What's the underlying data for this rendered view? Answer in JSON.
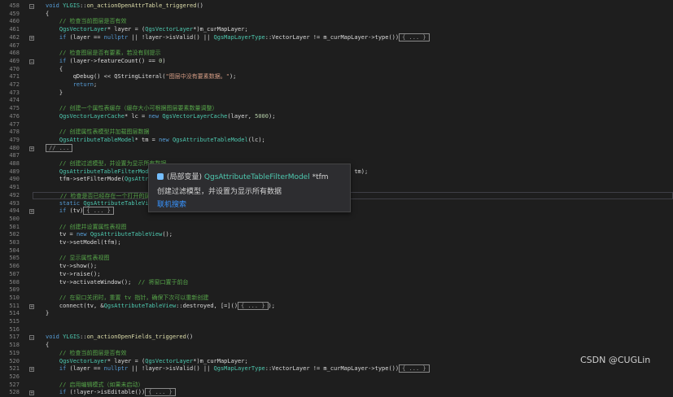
{
  "lines": [
    {
      "num": "458",
      "text": "void YLGIS::on_actionOpenAttrTable_triggered()",
      "type": "fn",
      "fold": "−"
    },
    {
      "num": "459",
      "text": "{",
      "type": "plain"
    },
    {
      "num": "460",
      "text": "    // 检查当前图层是否有效",
      "type": "cm"
    },
    {
      "num": "461",
      "text": "    QgsVectorLayer* layer = (QgsVectorLayer*)m_curMapLayer;",
      "type": "code"
    },
    {
      "num": "462",
      "text": "    if (layer == nullptr || !layer->isValid() || QgsMapLayerType::VectorLayer != m_curMapLayer->type())",
      "collapsed": "{ ... }",
      "type": "code",
      "fold": "+"
    },
    {
      "num": "467",
      "text": "",
      "type": "plain"
    },
    {
      "num": "468",
      "text": "    // 检查图层是否有要素，若没有则提示",
      "type": "cm"
    },
    {
      "num": "469",
      "text": "    if (layer->featureCount() == 0)",
      "type": "code",
      "fold": "−"
    },
    {
      "num": "470",
      "text": "    {",
      "type": "plain"
    },
    {
      "num": "471",
      "text": "        qDebug() << QStringLiteral(\"图层中没有要素数据。\");",
      "type": "code"
    },
    {
      "num": "472",
      "text": "        return;",
      "type": "kwline"
    },
    {
      "num": "473",
      "text": "    }",
      "type": "plain"
    },
    {
      "num": "474",
      "text": "",
      "type": "plain"
    },
    {
      "num": "475",
      "text": "    // 创建一个属性表缓存（缓存大小可根据图层要素数量调整）",
      "type": "cm"
    },
    {
      "num": "476",
      "text": "    QgsVectorLayerCache* lc = new QgsVectorLayerCache(layer, 5000);",
      "type": "code"
    },
    {
      "num": "477",
      "text": "",
      "type": "plain"
    },
    {
      "num": "478",
      "text": "    // 创建属性表模型并加载图层数据",
      "type": "cm"
    },
    {
      "num": "479",
      "text": "    QgsAttributeTableModel* tm = new QgsAttributeTableModel(lc);",
      "type": "code"
    },
    {
      "num": "480",
      "text": "",
      "collapsed": "// ...",
      "type": "code",
      "fold": "+"
    },
    {
      "num": "487",
      "text": "",
      "type": "plain"
    },
    {
      "num": "488",
      "text": "    // 创建过滤模型，并设置为显示所有数据",
      "type": "cm"
    },
    {
      "num": "489",
      "text": "    QgsAttributeTableFilterModel* tfm = new QgsAttributeTableFilterModel(m_mapCanvas, tm, tm);",
      "type": "code"
    },
    {
      "num": "490",
      "text": "    tfm->setFilterMode(QgsAttributeTab",
      "type": "code"
    },
    {
      "num": "491",
      "text": "",
      "type": "plain"
    },
    {
      "num": "492",
      "text": "    // 检查是否已经存在一个打开的属性",
      "type": "cm",
      "highlight": true
    },
    {
      "num": "493",
      "text": "    static QgsAttributeTableView* tv =",
      "type": "code"
    },
    {
      "num": "494",
      "text": "    if (tv)",
      "collapsed": "{ ... }",
      "type": "code",
      "fold": "+"
    },
    {
      "num": "500",
      "text": "",
      "type": "plain"
    },
    {
      "num": "501",
      "text": "    // 创建并设置属性表视图",
      "type": "cm"
    },
    {
      "num": "502",
      "text": "    tv = new QgsAttributeTableView();",
      "type": "code"
    },
    {
      "num": "503",
      "text": "    tv->setModel(tfm);",
      "type": "code"
    },
    {
      "num": "504",
      "text": "",
      "type": "plain"
    },
    {
      "num": "505",
      "text": "    // 显示属性表视图",
      "type": "cm"
    },
    {
      "num": "506",
      "text": "    tv->show();",
      "type": "code"
    },
    {
      "num": "507",
      "text": "    tv->raise();",
      "type": "code"
    },
    {
      "num": "508",
      "text": "    tv->activateWindow();  // 将窗口置于前台",
      "type": "code"
    },
    {
      "num": "509",
      "text": "",
      "type": "plain"
    },
    {
      "num": "510",
      "text": "    // 在窗口关闭时，重置 tv 指针，确保下次可以重新创建",
      "type": "cm"
    },
    {
      "num": "511",
      "text": "    connect(tv, &QgsAttributeTableView::destroyed, [=]()",
      "collapsed": "{ ... }",
      "tail": ");",
      "type": "code",
      "fold": "+"
    },
    {
      "num": "514",
      "text": "}",
      "type": "plain"
    },
    {
      "num": "515",
      "text": "",
      "type": "plain"
    },
    {
      "num": "516",
      "text": "",
      "type": "plain"
    },
    {
      "num": "517",
      "text": "void YLGIS::on_actionOpenFields_triggered()",
      "type": "fn",
      "fold": "−"
    },
    {
      "num": "518",
      "text": "{",
      "type": "plain"
    },
    {
      "num": "519",
      "text": "    // 检查当前图层是否有效",
      "type": "cm"
    },
    {
      "num": "520",
      "text": "    QgsVectorLayer* layer = (QgsVectorLayer*)m_curMapLayer;",
      "type": "code"
    },
    {
      "num": "521",
      "text": "    if (layer == nullptr || !layer->isValid() || QgsMapLayerType::VectorLayer != m_curMapLayer->type())",
      "collapsed": "{ ... }",
      "type": "code",
      "fold": "+"
    },
    {
      "num": "526",
      "text": "",
      "type": "plain"
    },
    {
      "num": "527",
      "text": "    // 启用编辑模式（如果未启动）",
      "type": "cm"
    },
    {
      "num": "528",
      "text": "    if (!layer->isEditable())",
      "collapsed": "{ ... }",
      "type": "code",
      "fold": "+"
    }
  ],
  "tooltip": {
    "scope": "(局部变量)",
    "type_name": "QgsAttributeTableFilterModel",
    "var_name": "*tfm",
    "description": "创建过滤模型，并设置为显示所有数据",
    "link": "联机搜索"
  },
  "watermark": "CSDN @CUGLin",
  "colors": {
    "background": "#1e1e1e",
    "comment": "#57a64a",
    "keyword": "#569cd6",
    "type": "#4ec9b0",
    "link": "#3794ff"
  }
}
